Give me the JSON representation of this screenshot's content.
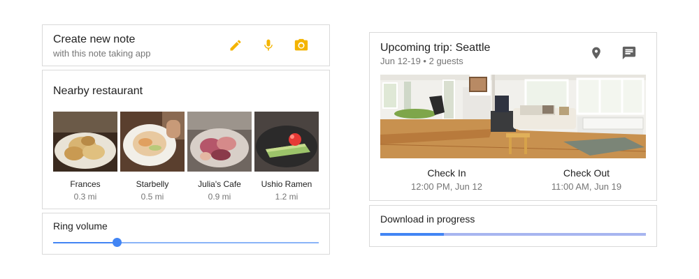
{
  "note": {
    "title": "Create new note",
    "subtitle": "with this note taking app",
    "icons": [
      "pencil-icon",
      "microphone-icon",
      "camera-icon"
    ],
    "icon_color": "#f4b400"
  },
  "restaurants": {
    "title": "Nearby restaurant",
    "items": [
      {
        "name": "Frances",
        "distance": "0.3 mi"
      },
      {
        "name": "Starbelly",
        "distance": "0.5 mi"
      },
      {
        "name": "Julia's Cafe",
        "distance": "0.9 mi"
      },
      {
        "name": "Ushio Ramen",
        "distance": "1.2 mi"
      }
    ]
  },
  "ring": {
    "label": "Ring volume",
    "value": 0.24,
    "accent": "#4285f4"
  },
  "trip": {
    "title": "Upcoming trip: Seattle",
    "subtitle": "Jun 12-19 • 2 guests",
    "icons": [
      "map-pin-icon",
      "message-icon"
    ],
    "check_in": {
      "label": "Check In",
      "value": "12:00 PM, Jun 12"
    },
    "check_out": {
      "label": "Check Out",
      "value": "11:00 AM, Jun 19"
    }
  },
  "download": {
    "label": "Download in progress",
    "progress": 0.24,
    "accent": "#4285f4"
  }
}
